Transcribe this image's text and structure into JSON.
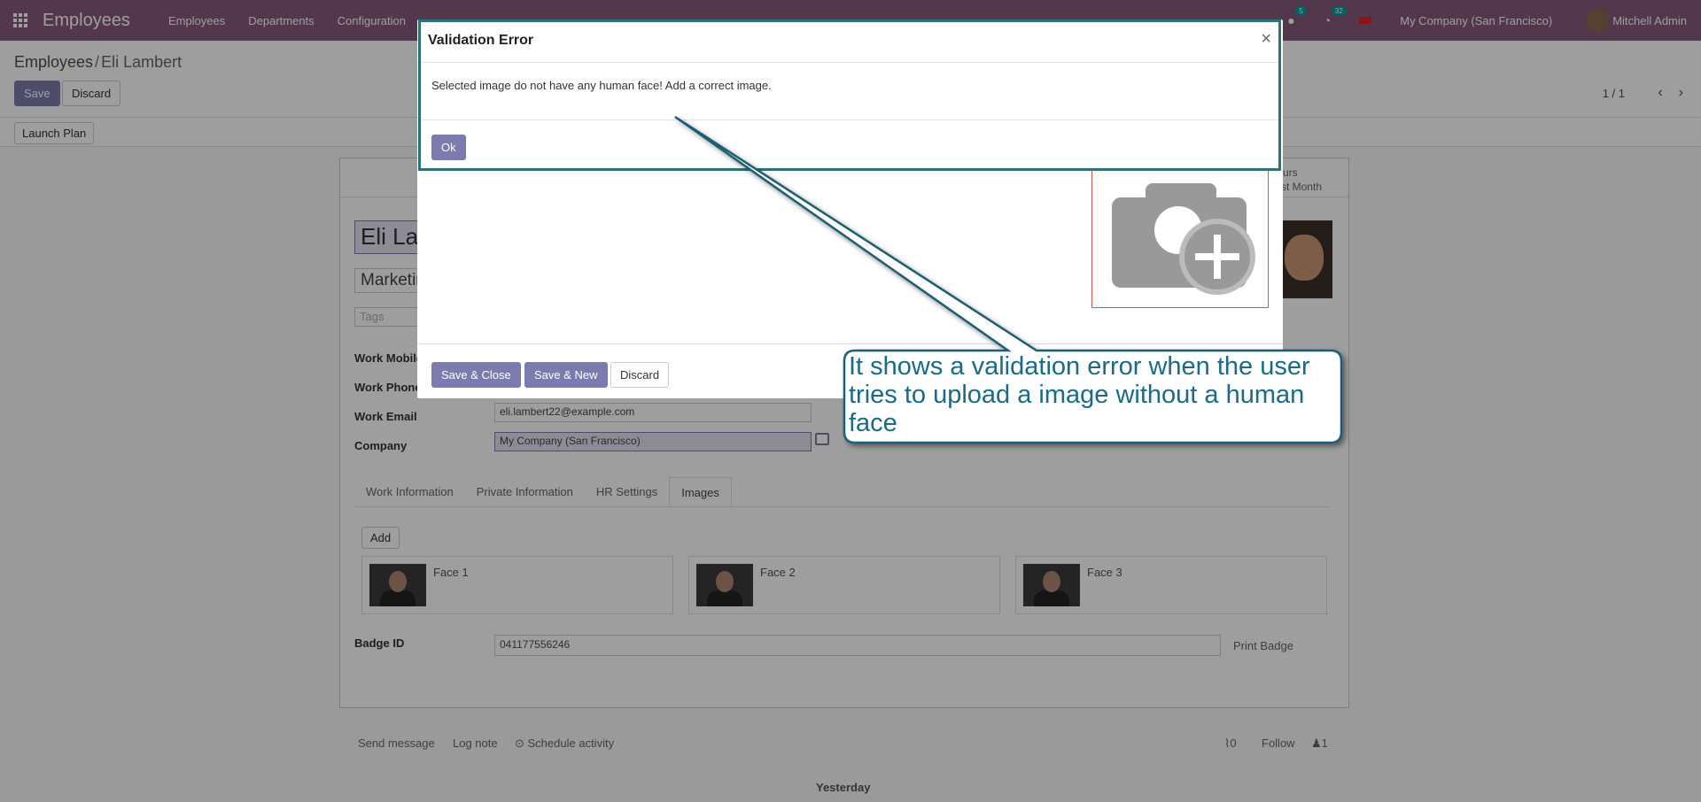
{
  "navbar": {
    "brand": "Employees",
    "menu": [
      "Employees",
      "Departments",
      "Configuration"
    ],
    "chat_badge": "5",
    "activity_badge": "32",
    "company": "My Company (San Francisco)",
    "user": "Mitchell Admin"
  },
  "breadcrumb": {
    "parent": "Employees",
    "current": "Eli Lambert"
  },
  "control": {
    "save": "Save",
    "discard": "Discard",
    "pager": "1 / 1",
    "launch_plan": "Launch Plan"
  },
  "form": {
    "name": "Eli Lambert",
    "job_title": "Marketing and Community Manager",
    "tags_placeholder": "Tags",
    "stat_button": {
      "line1": "Hours",
      "line2": "Last Month"
    },
    "labels": {
      "work_mobile": "Work Mobile",
      "work_phone": "Work Phone",
      "work_email": "Work Email",
      "company": "Company"
    },
    "work_email": "eli.lambert22@example.com",
    "company": "My Company (San Francisco)",
    "tabs": [
      "Work Information",
      "Private Information",
      "HR Settings",
      "Images"
    ],
    "add": "Add",
    "faces": [
      "Face 1",
      "Face 2",
      "Face 3"
    ],
    "badge_label": "Badge ID",
    "badge_id": "041177556246",
    "print_badge": "Print Badge"
  },
  "chatter": {
    "send_message": "Send message",
    "log_note": "Log note",
    "schedule": "Schedule activity",
    "attachments": "0",
    "follow": "Follow",
    "followers": "1",
    "yesterday": "Yesterday"
  },
  "modal_under": {
    "save_close": "Save & Close",
    "save_new": "Save & New",
    "discard": "Discard"
  },
  "error_dialog": {
    "title": "Validation Error",
    "close": "×",
    "message": "Selected image do not have any human face! Add a correct image.",
    "ok": "Ok"
  },
  "callout": {
    "text": "It shows a validation error when the user tries to upload a image without a human face"
  },
  "colors": {
    "navbar": "#875a7b",
    "primary": "#7c7bad",
    "callout": "#1b6a86"
  }
}
